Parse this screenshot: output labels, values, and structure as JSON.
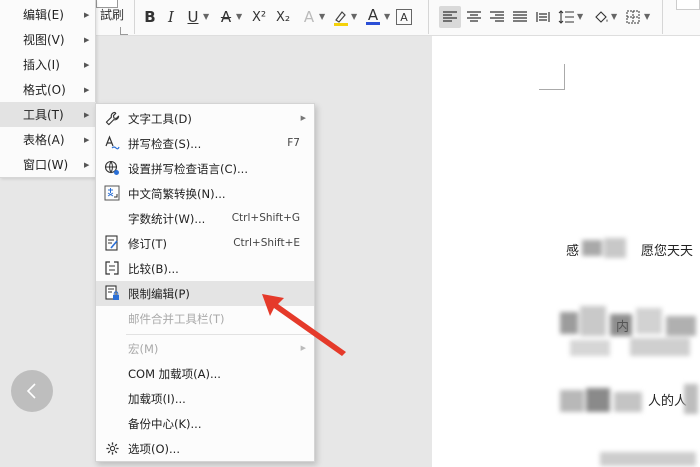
{
  "toolbar": {
    "partial_label": "試刷",
    "buttons": [
      {
        "name": "bold-button",
        "glyph": "B"
      },
      {
        "name": "italic-button",
        "glyph": "I"
      },
      {
        "name": "underline-button",
        "glyph": "U"
      },
      {
        "name": "strikethrough-button",
        "glyph": "A"
      },
      {
        "name": "superscript-button",
        "glyph": "X²"
      },
      {
        "name": "subscript-button",
        "glyph": "X₂"
      },
      {
        "name": "text-effect-button",
        "glyph": "A"
      },
      {
        "name": "highlight-button",
        "glyph": "A"
      },
      {
        "name": "font-color-button",
        "glyph": "A"
      },
      {
        "name": "char-border-button",
        "glyph": "A"
      }
    ],
    "colors": {
      "highlight": "#f5d20b",
      "font_color": "#2b4fd6",
      "strike": "#555555"
    }
  },
  "main_menu": {
    "items": [
      {
        "label": "编辑(E)"
      },
      {
        "label": "视图(V)"
      },
      {
        "label": "插入(I)"
      },
      {
        "label": "格式(O)"
      },
      {
        "label": "工具(T)"
      },
      {
        "label": "表格(A)"
      },
      {
        "label": "窗口(W)"
      }
    ]
  },
  "tools_menu": {
    "items": [
      {
        "label": "文字工具(D)",
        "icon": "wrench-icon",
        "shortcut": ""
      },
      {
        "label": "拼写检查(S)...",
        "icon": "spellcheck-icon",
        "shortcut": "F7"
      },
      {
        "label": "设置拼写检查语言(C)...",
        "icon": "globe-icon",
        "shortcut": ""
      },
      {
        "label": "中文简繁转换(N)...",
        "icon": "chinese-convert-icon",
        "shortcut": ""
      },
      {
        "label": "字数统计(W)...",
        "icon": "",
        "shortcut": "Ctrl+Shift+G"
      },
      {
        "label": "修订(T)",
        "icon": "track-changes-icon",
        "shortcut": "Ctrl+Shift+E"
      },
      {
        "label": "比较(B)...",
        "icon": "compare-icon",
        "shortcut": ""
      },
      {
        "label": "限制编辑(P)",
        "icon": "restrict-edit-icon",
        "shortcut": ""
      },
      {
        "label": "邮件合并工具栏(T)",
        "icon": "",
        "shortcut": ""
      },
      {
        "label": "宏(M)",
        "icon": "",
        "shortcut": ""
      },
      {
        "label": "COM 加载项(A)...",
        "icon": "",
        "shortcut": ""
      },
      {
        "label": "加载项(I)...",
        "icon": "",
        "shortcut": ""
      },
      {
        "label": "备份中心(K)...",
        "icon": "",
        "shortcut": ""
      },
      {
        "label": "选项(O)...",
        "icon": "gear-icon",
        "shortcut": ""
      }
    ]
  },
  "document": {
    "line1_start": "感",
    "line1_end": "愿您天天",
    "line3_end": "人的人",
    "line2_fragment": "内"
  },
  "colors": {
    "annotation_arrow": "#e53a2a",
    "menu_highlight": "#e4e4e4"
  }
}
